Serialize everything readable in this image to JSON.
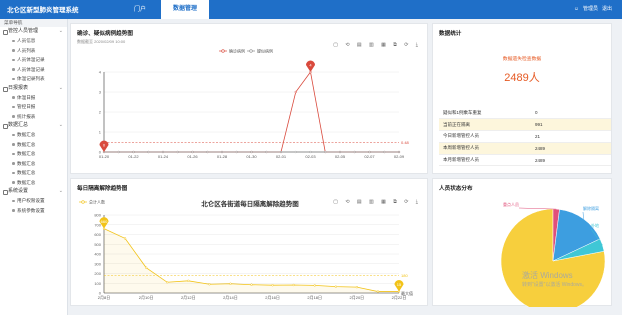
{
  "header": {
    "app_title": "北仑区新型肺炎管理系统",
    "menu_label": "门户",
    "active_tab": "数据管理",
    "user": "管理员",
    "logout": "退出"
  },
  "sidebar": {
    "head": "菜单导航",
    "groups": [
      {
        "label": "管控人员管理",
        "items": [
          "人员信息",
          "人员列表",
          "人员体温记录",
          "人员体温记录",
          "体温记录列表"
        ]
      },
      {
        "label": "日报报表",
        "items": [
          "体温日报",
          "管控日报",
          "统计报表"
        ]
      },
      {
        "label": "数据汇总",
        "items": [
          "数据汇总",
          "数据汇总",
          "数据汇总",
          "数据汇总",
          "数据汇总",
          "数据汇总"
        ]
      },
      {
        "label": "系统设置",
        "items": [
          "用户权限设置",
          "系统参数设置"
        ]
      }
    ]
  },
  "panel1": {
    "title": "确诊、疑似病例趋势图",
    "subtitle": "数据截至 2020/02/09 10:00",
    "legend": [
      "确诊病例",
      "疑似病例"
    ],
    "tools": "▢ ⟲ ▤ ▥ ▦ ⧉ ⟳ ⤓",
    "avg_label": "0.48"
  },
  "panel2": {
    "title": "每日隔离解除趋势图",
    "chart_title": "北仑区各街道每日隔离解除趋势图",
    "legend": [
      "总计人数"
    ],
    "tools": "▢ ⟲ ▤ ▥ ▦ ⧉ ⟳ ⤓",
    "avg_label": "180"
  },
  "stats": {
    "title": "数据统计",
    "main_label": "数据遗失检查数据",
    "main_value": "2489人",
    "rows": [
      {
        "label": "疑似和1例乘车重复",
        "value": "0"
      },
      {
        "label": "当前正在隔离",
        "value": "991"
      },
      {
        "label": "今日新增管控人员",
        "value": "21"
      },
      {
        "label": "本周新增管控人员",
        "value": "2489"
      },
      {
        "label": "本月新增管控人员",
        "value": "2489"
      }
    ]
  },
  "pie_panel": {
    "title": "人员状态分布",
    "labels": [
      "隔离中",
      "解除隔离",
      "外地",
      "重点人员"
    ]
  },
  "watermark": {
    "line1": "激活 Windows",
    "line2": "转到“设置”以激活 Windows。"
  },
  "chart_data": [
    {
      "type": "line",
      "title": "确诊、疑似病例趋势图",
      "x": [
        "01-20",
        "01-21",
        "01-22",
        "01-23",
        "01-24",
        "01-25",
        "01-26",
        "01-27",
        "01-28",
        "01-29",
        "01-30",
        "01-31",
        "02-01",
        "02-02",
        "02-03",
        "02-04",
        "02-05",
        "02-06",
        "02-07",
        "02-08",
        "02-09"
      ],
      "x_tick_labels": [
        "01-20",
        "01-22",
        "01-24",
        "01-26",
        "01-28",
        "01-30",
        "02-01",
        "02-03",
        "02-05",
        "02-07",
        "02-09"
      ],
      "ylim": [
        0,
        4
      ],
      "y_ticks": [
        0,
        1,
        2,
        3,
        4
      ],
      "series": [
        {
          "name": "确诊病例",
          "color": "#d94a3d",
          "values": [
            0,
            0,
            0,
            0,
            0,
            0,
            0,
            0,
            0,
            0,
            0,
            0,
            0,
            3,
            4,
            0,
            0,
            0,
            0,
            0,
            0
          ]
        },
        {
          "name": "疑似病例",
          "color": "#8b8b8b",
          "values": [
            0,
            0,
            0,
            0,
            0,
            0,
            0,
            0,
            0,
            0,
            0,
            0,
            0,
            0,
            0,
            0,
            0,
            0,
            0,
            0,
            0
          ]
        }
      ],
      "markers": [
        {
          "x": "01-20",
          "value": 0
        },
        {
          "x": "02-03",
          "value": 4
        }
      ],
      "average": 0.48,
      "legend_position": "top-right"
    },
    {
      "type": "line",
      "title": "北仑区各街道每日隔离解除趋势图",
      "x": [
        "2月8日",
        "2月9日",
        "2月10日",
        "2月11日",
        "2月12日",
        "2月13日",
        "2月14日",
        "2月15日",
        "2月16日",
        "2月17日",
        "2月18日",
        "2月19日",
        "2月20日",
        "2月21日",
        "2月22日"
      ],
      "x_tick_labels": [
        "2月8日",
        "2月10日",
        "2月12日",
        "2月14日",
        "2月16日",
        "2月18日",
        "2月20日",
        "2月22日"
      ],
      "xlabel": "最大值",
      "ylim": [
        0,
        800
      ],
      "y_ticks": [
        0,
        100,
        200,
        300,
        400,
        500,
        600,
        700,
        800
      ],
      "series": [
        {
          "name": "总计人数",
          "color": "#f2c318",
          "values": [
            660,
            560,
            260,
            110,
            125,
            90,
            95,
            85,
            80,
            82,
            78,
            65,
            60,
            15,
            15
          ]
        }
      ],
      "markers": [
        {
          "x": "2月8日",
          "value": 660
        },
        {
          "x": "2月22日",
          "value": 15
        }
      ],
      "average": 180,
      "legend_position": "top-left"
    },
    {
      "type": "pie",
      "title": "人员状态分布",
      "labels": [
        "隔离中",
        "解除隔离",
        "外地",
        "重点人员"
      ],
      "values": [
        78,
        16,
        4,
        2
      ],
      "colors": [
        "#f7cf3d",
        "#3d9ee0",
        "#3fc7d6",
        "#e0507a"
      ]
    }
  ]
}
